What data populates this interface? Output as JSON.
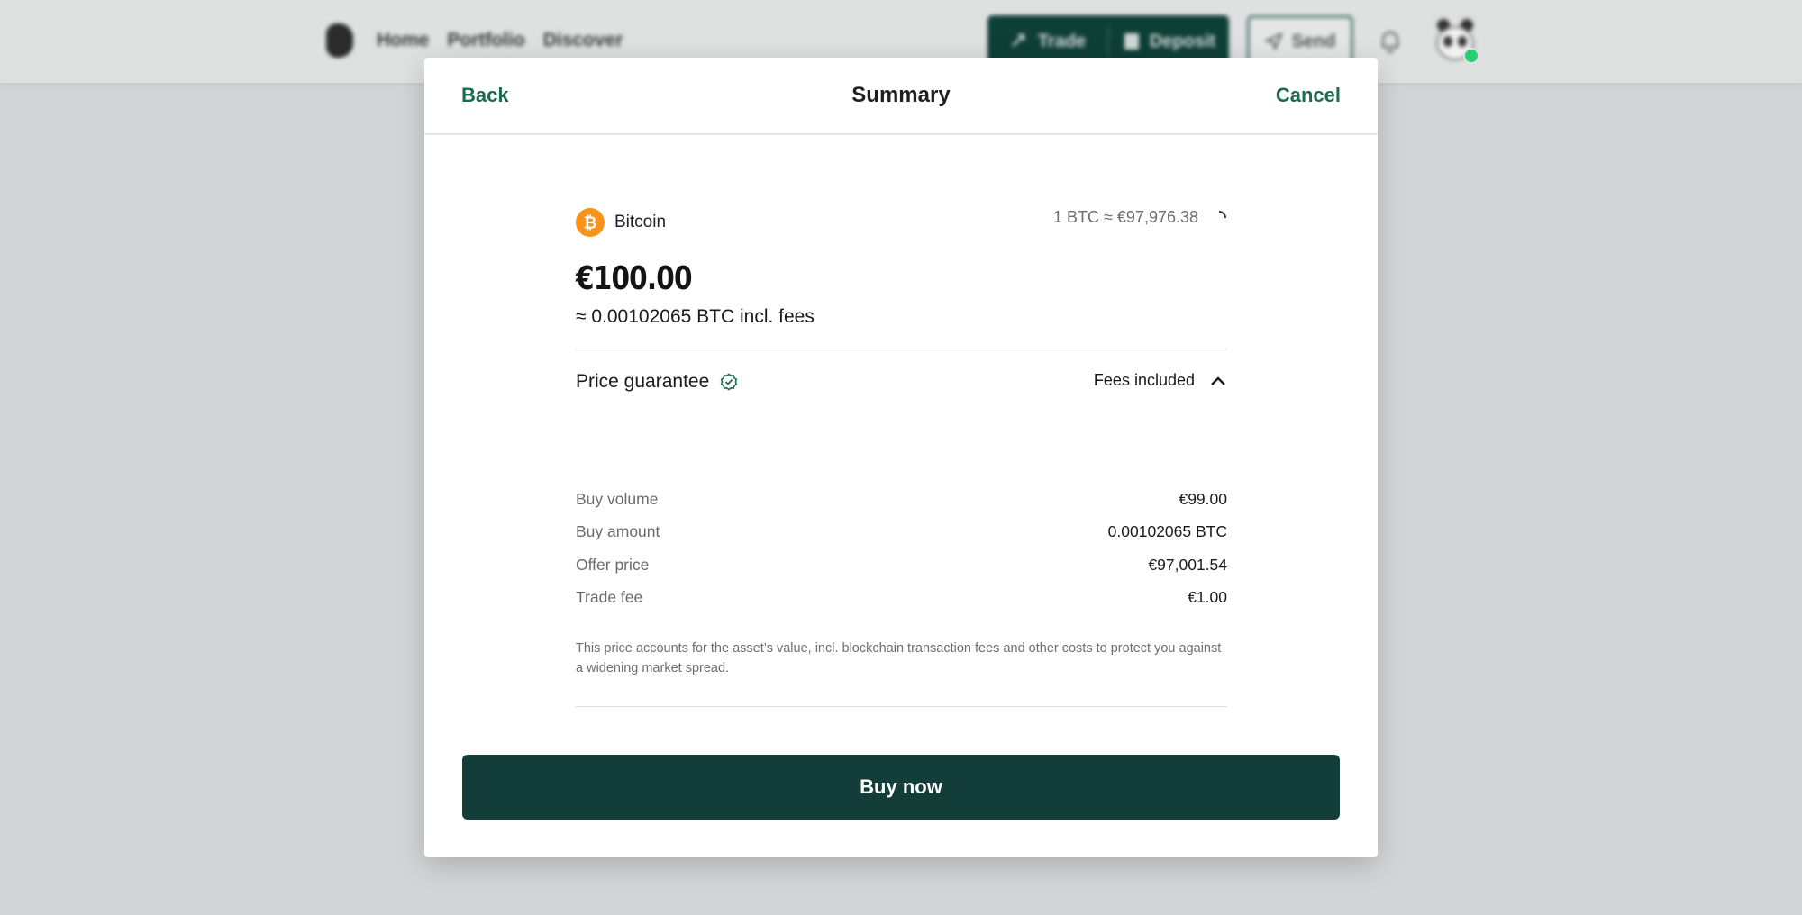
{
  "app": {
    "nav": [
      "Home",
      "Portfolio",
      "Discover"
    ],
    "buttons": {
      "trade": "Trade",
      "deposit": "Deposit",
      "send": "Send"
    }
  },
  "modal": {
    "back_label": "Back",
    "title": "Summary",
    "cancel_label": "Cancel",
    "asset": {
      "name": "Bitcoin",
      "icon": "bitcoin-icon"
    },
    "rate": "1 BTC ≈ €97,976.38",
    "amount": "€100.00",
    "amount_sub": "≈ 0.00102065 BTC incl. fees",
    "price_guarantee_label": "Price guarantee",
    "fees_toggle_label": "Fees included",
    "details": [
      {
        "label": "Buy volume",
        "value": "€99.00"
      },
      {
        "label": "Buy amount",
        "value": "0.00102065 BTC"
      },
      {
        "label": "Offer price",
        "value": "€97,001.54"
      },
      {
        "label": "Trade fee",
        "value": "€1.00"
      }
    ],
    "note": "This price accounts for the asset’s value, incl. blockchain transaction fees and other costs to protect you against a widening market spread.",
    "buy_label": "Buy now"
  },
  "colors": {
    "accent": "#1b6b52",
    "primary_button": "#123d38",
    "bitcoin": "#f7931a",
    "overlay": "#d3d4d5"
  }
}
